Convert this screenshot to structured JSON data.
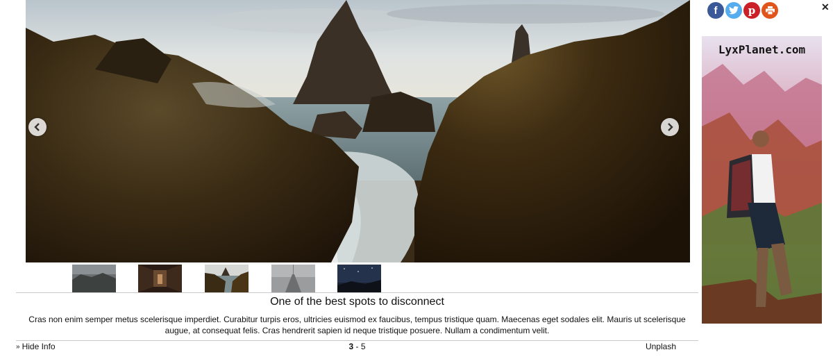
{
  "slideshow": {
    "title": "One of the best spots to disconnect",
    "description": "Cras non enim semper metus scelerisque imperdiet. Curabitur turpis eros, ultricies euismod ex faucibus, tempus tristique quam. Maecenas eget sodales elit. Mauris ut scelerisque augue, at consequat felis. Cras hendrerit sapien id neque tristique posuere. Nullam a condimentum velit.",
    "hide_info_label": "Hide Info",
    "counter_current": "3",
    "counter_separator": " - ",
    "counter_total": "5",
    "source": "Unplash",
    "thumbnails": [
      {
        "name": "cliffs-gray-sky"
      },
      {
        "name": "dark-corridor"
      },
      {
        "name": "sea-rocks"
      },
      {
        "name": "foggy-bridge"
      },
      {
        "name": "night-sky"
      }
    ],
    "active_thumbnail_index": 2
  },
  "share": {
    "icons": [
      "facebook-icon",
      "twitter-icon",
      "pinterest-icon",
      "print-icon"
    ],
    "colors": {
      "facebook": "#3b5998",
      "twitter": "#55acee",
      "pinterest": "#cb2027",
      "print": "#e0551b"
    }
  },
  "ad": {
    "brand": "LyxPlanet.com"
  }
}
